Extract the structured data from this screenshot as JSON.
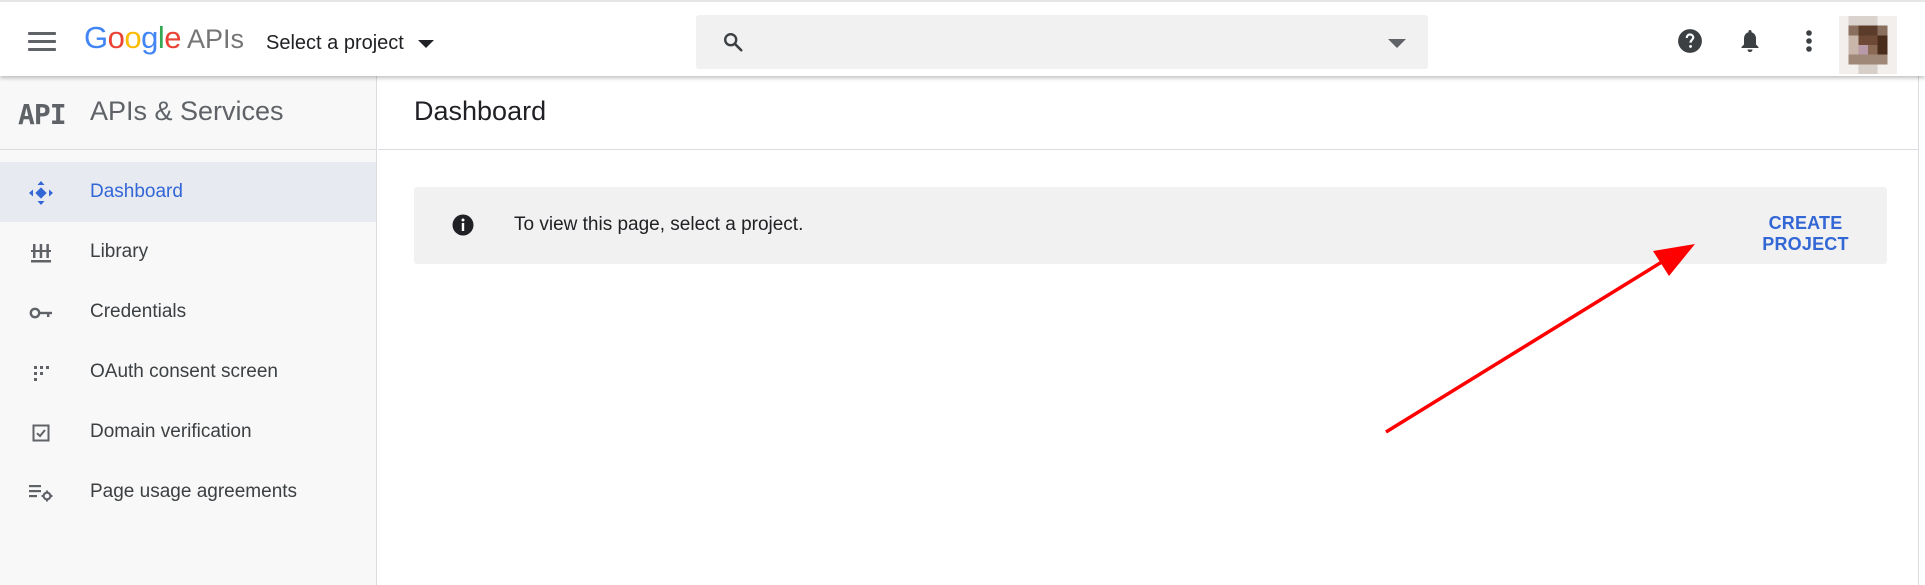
{
  "topbar": {
    "logo_letters": [
      "G",
      "o",
      "o",
      "g",
      "l",
      "e"
    ],
    "logo_colors": [
      "#4285f4",
      "#ea4335",
      "#fbbc05",
      "#4285f4",
      "#34a853",
      "#ea4335"
    ],
    "logo_suffix": "APIs",
    "project_select_label": "Select a project",
    "search_placeholder": "",
    "icons": [
      "menu-icon",
      "search-icon",
      "chevron-down-icon",
      "help-icon",
      "bell-icon",
      "more-vert-icon"
    ]
  },
  "sidebar": {
    "mark": "API",
    "title": "APIs & Services",
    "items": [
      {
        "label": "Dashboard",
        "icon": "dashboard-icon",
        "active": true
      },
      {
        "label": "Library",
        "icon": "library-icon",
        "active": false
      },
      {
        "label": "Credentials",
        "icon": "key-icon",
        "active": false
      },
      {
        "label": "OAuth consent screen",
        "icon": "oauth-consent-icon",
        "active": false
      },
      {
        "label": "Domain verification",
        "icon": "checkbox-icon",
        "active": false
      },
      {
        "label": "Page usage agreements",
        "icon": "settings-list-icon",
        "active": false
      }
    ]
  },
  "main": {
    "title": "Dashboard",
    "notice_text": "To view this page, select a project.",
    "create_project_label": "CREATE PROJECT"
  },
  "colors": {
    "accent": "#3367d6",
    "annotation_arrow": "#ff0000"
  }
}
